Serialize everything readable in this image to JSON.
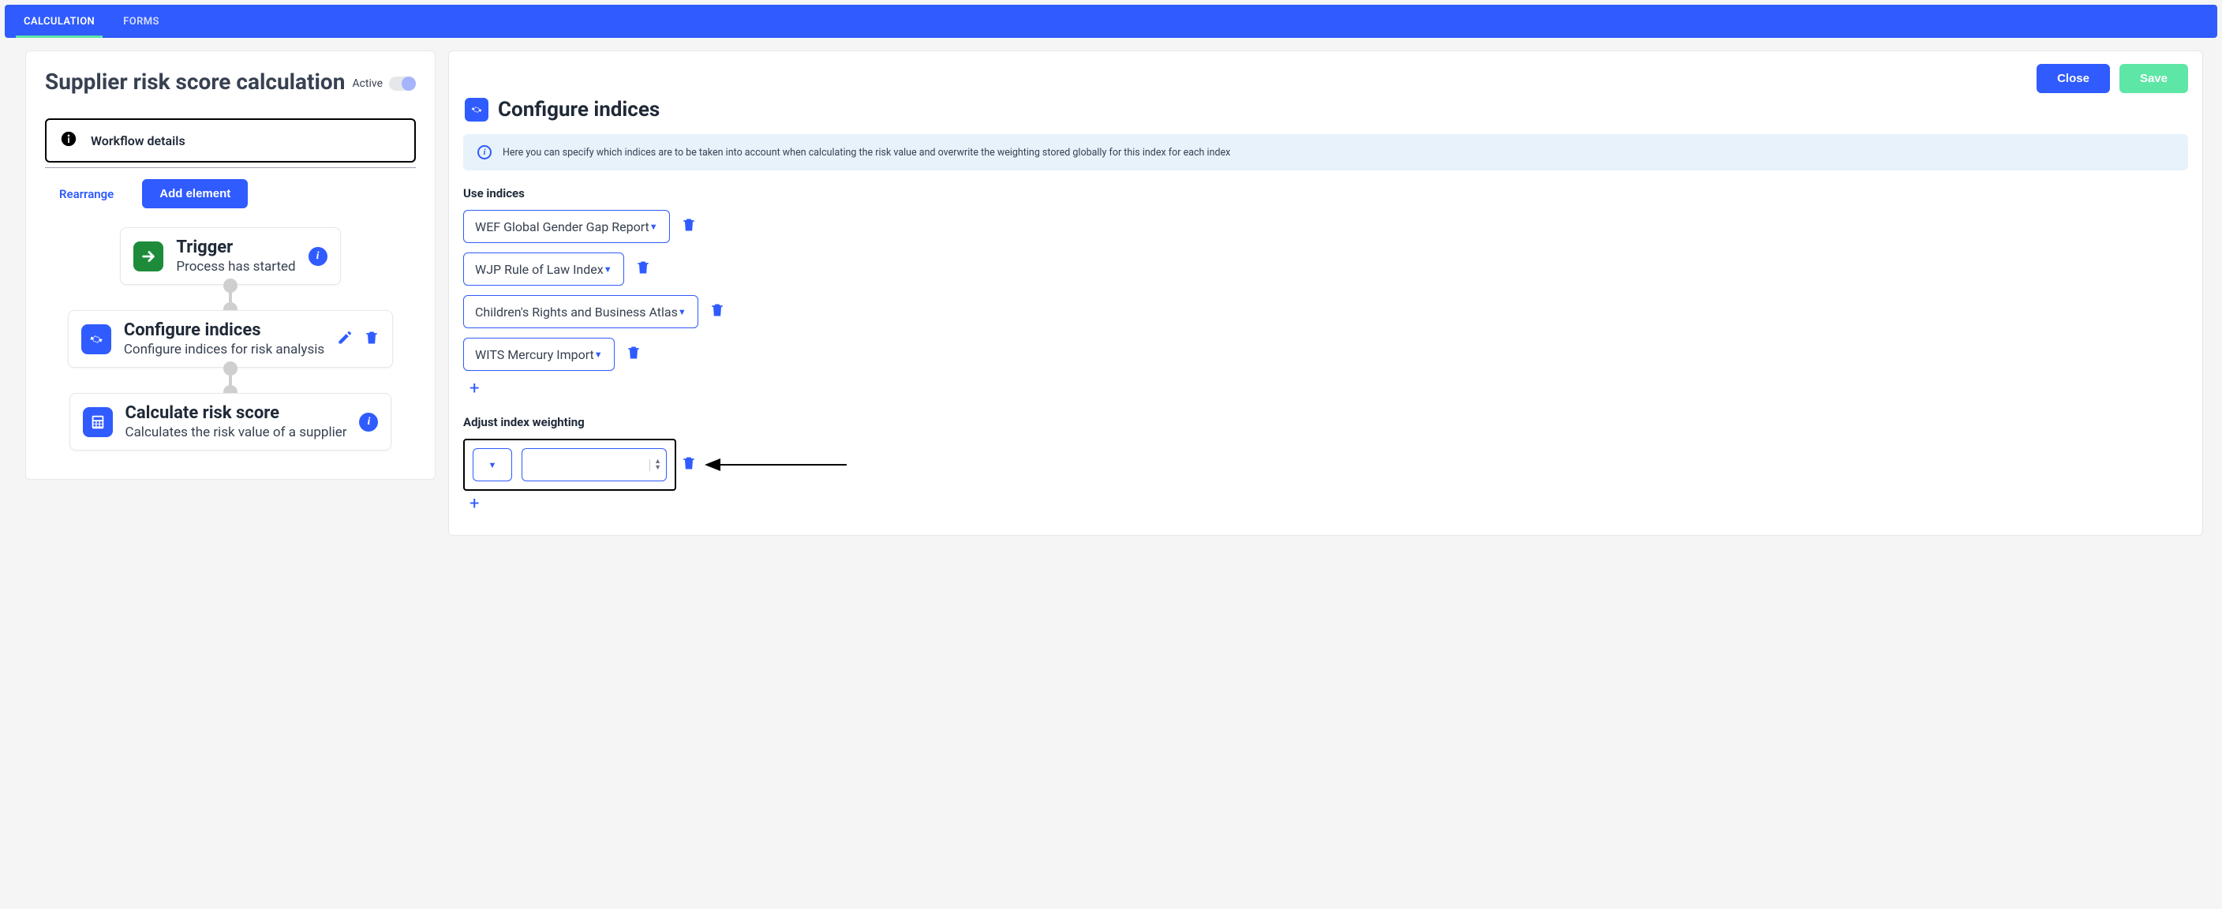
{
  "tabs": {
    "calculation": "CALCULATION",
    "forms": "FORMS"
  },
  "left": {
    "title": "Supplier risk score calculation",
    "active_label": "Active",
    "workflow_details": "Workflow details",
    "rearrange": "Rearrange",
    "add_element": "Add element",
    "nodes": {
      "trigger_title": "Trigger",
      "trigger_sub": "Process has started",
      "configure_title": "Configure indices",
      "configure_sub": "Configure indices for risk analysis",
      "calculate_title": "Calculate risk score",
      "calculate_sub": "Calculates the risk value of a supplier"
    }
  },
  "right": {
    "close": "Close",
    "save": "Save",
    "section_title": "Configure indices",
    "banner": "Here you can specify which indices are to be taken into account when calculating the risk value and overwrite the weighting stored globally for this index for each index",
    "use_indices_label": "Use indices",
    "indices": [
      "WEF Global Gender Gap Report",
      "WJP Rule of Law Index",
      "Children's Rights and Business Atlas",
      "WITS Mercury Import"
    ],
    "adjust_label": "Adjust index weighting",
    "weight_value": ""
  }
}
